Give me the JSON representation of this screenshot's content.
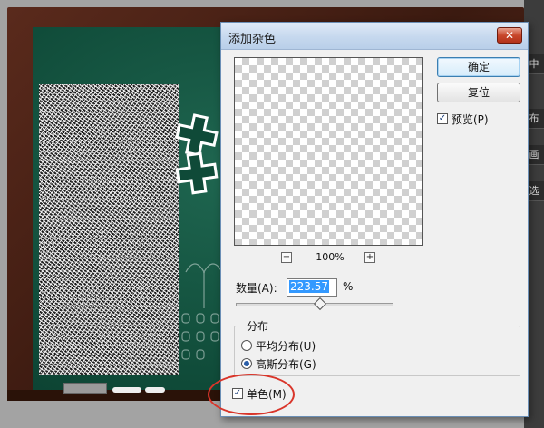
{
  "dialog": {
    "title": "添加杂色",
    "close_glyph": "✕",
    "ok_label": "确定",
    "reset_label": "复位",
    "preview_label": "预览(P)",
    "preview_checked": true,
    "zoom": {
      "minus": "−",
      "plus": "+",
      "value": "100%"
    },
    "amount": {
      "label": "数量(A):",
      "value": "223.57",
      "unit": "%",
      "slider_level_percent": 55.9
    },
    "distribution": {
      "legend": "分布",
      "options": [
        {
          "label": "平均分布(U)",
          "selected": false
        },
        {
          "label": "高斯分布(G)",
          "selected": true
        }
      ]
    },
    "monochrome_label": "单色(M)",
    "monochrome_checked": true,
    "checkmark": "✓"
  },
  "right_panel": {
    "tabs": [
      "中",
      "布",
      "画",
      "选"
    ]
  },
  "colors": {
    "annotation": "#d9352a",
    "selection": "#3399ff",
    "chalkboard": "#0f4a38"
  }
}
